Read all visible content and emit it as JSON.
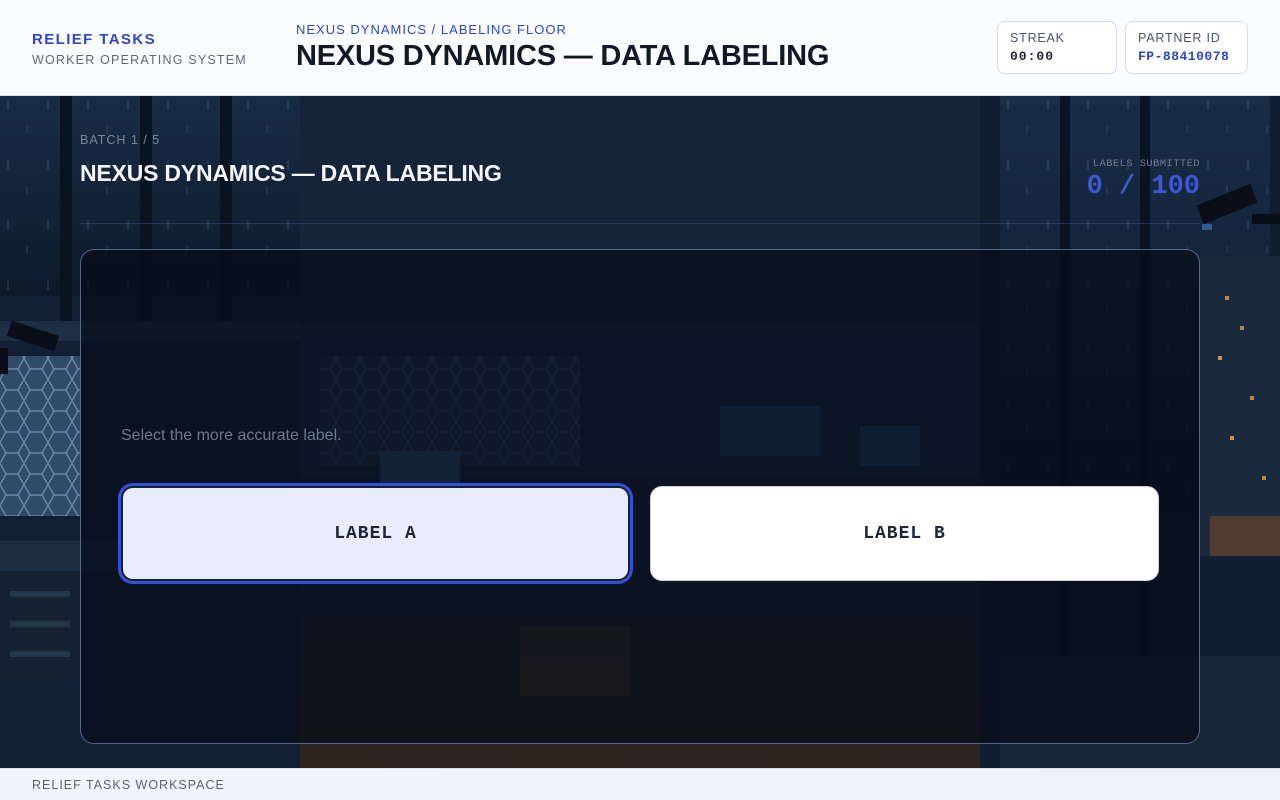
{
  "brand": {
    "title": "RELIEF TASKS",
    "subtitle": "WORKER OPERATING SYSTEM"
  },
  "header": {
    "breadcrumb": "NEXUS DYNAMICS / LABELING FLOOR",
    "title": "NEXUS DYNAMICS — DATA LABELING"
  },
  "stats": {
    "streak": {
      "label": "STREAK",
      "value": "00:00"
    },
    "partner": {
      "label": "PARTNER ID",
      "value": "FP-88410078"
    }
  },
  "task": {
    "batch": "BATCH 1 / 5",
    "title": "NEXUS DYNAMICS — DATA LABELING",
    "counter_label": "LABELS SUBMITTED",
    "counter_value": "0 / 100",
    "prompt": "Select the more accurate label.",
    "options": [
      {
        "label": "LABEL A",
        "selected": true
      },
      {
        "label": "LABEL B",
        "selected": false
      }
    ]
  },
  "footer": {
    "text": "RELIEF TASKS WORKSPACE"
  },
  "colors": {
    "accent": "#2e47c6",
    "selection_ring": "#3350d8",
    "panel_bg": "#070c19",
    "header_bg": "#fbfcfe"
  }
}
